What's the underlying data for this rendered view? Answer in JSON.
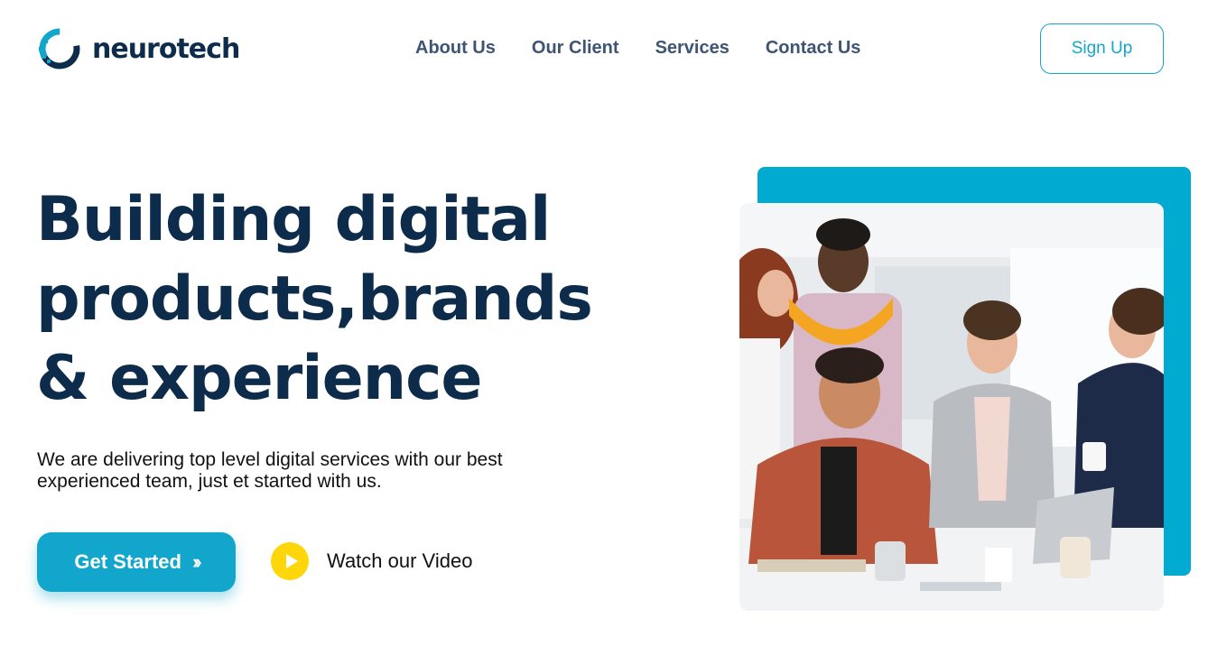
{
  "brand": {
    "name": "neurotech"
  },
  "nav": {
    "items": [
      {
        "label": "About Us"
      },
      {
        "label": "Our Client"
      },
      {
        "label": "Services"
      },
      {
        "label": "Contact Us"
      }
    ],
    "signup_label": "Sign Up"
  },
  "hero": {
    "title_lines": [
      "Building digital",
      "products,brands",
      "& experience"
    ],
    "description": "We are delivering top level digital services with our best experienced team, just et started with us.",
    "cta_label": "Get Started",
    "cta_icon": "double-chevron-right-icon",
    "video_label": "Watch our Video",
    "video_icon": "play-icon"
  },
  "colors": {
    "brand_blue": "#13a6cc",
    "accent_block": "#00aad1",
    "heading": "#0d2b4a",
    "nav": "#3d5573",
    "play_yellow": "#ffd60a"
  }
}
